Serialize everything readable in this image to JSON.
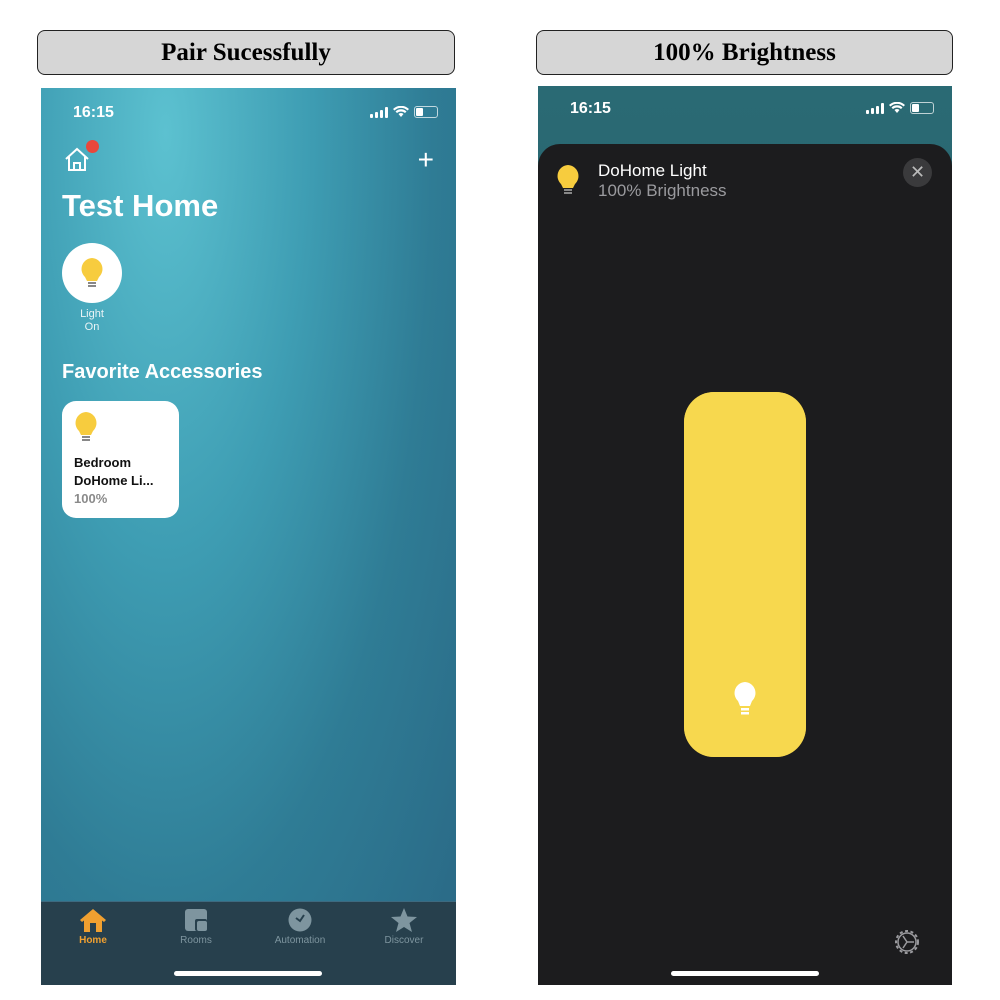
{
  "captions": {
    "left": "Pair Sucessfully",
    "right": "100% Brightness"
  },
  "left_screen": {
    "status": {
      "time": "16:15"
    },
    "home_icon": "house-icon",
    "notification_badge_color": "#e9473b",
    "add_icon": "plus-icon",
    "title": "Test Home",
    "status_tile": {
      "icon": "lightbulb-icon",
      "line1": "Light",
      "line2": "On"
    },
    "section_title": "Favorite Accessories",
    "accessory": {
      "room": "Bedroom",
      "name": "DoHome Li...",
      "value": "100%"
    },
    "tabs": [
      {
        "label": "Home",
        "icon": "house-icon",
        "active": true
      },
      {
        "label": "Rooms",
        "icon": "rooms-icon"
      },
      {
        "label": "Automation",
        "icon": "clock-icon"
      },
      {
        "label": "Discover",
        "icon": "star-icon"
      }
    ],
    "accent": "#f0a030"
  },
  "right_screen": {
    "status": {
      "time": "16:15"
    },
    "device_name": "DoHome Light",
    "device_status": "100% Brightness",
    "brightness_percent": 100,
    "slider_color": "#f7d84e",
    "close_icon": "close-icon",
    "settings_icon": "gear-icon"
  }
}
